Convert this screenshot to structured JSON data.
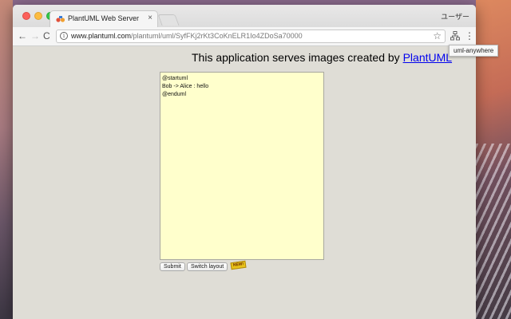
{
  "browser": {
    "tab_title": "PlantUML Web Server",
    "tab_close": "×",
    "profile_name": "ユーザー",
    "url_host": "www.plantuml.com",
    "url_path": "/plantuml/uml/SyfFKj2rKt3CoKnELR1Io4ZDoSa70000",
    "extension_tooltip": "uml-anywhere",
    "back": "←",
    "forward": "→",
    "reload": "C",
    "star": "☆",
    "menu": "⋮",
    "info": "i"
  },
  "page": {
    "heading_prefix": "This application serves images created by ",
    "heading_link": "PlantUML",
    "editor_text": "@startuml\nBob -> Alice : hello\n@enduml",
    "submit_label": "Submit",
    "switch_layout_label": "Switch layout",
    "new_badge": "NEW!"
  },
  "colors": {
    "editor_background": "#ffffcc",
    "page_background": "#dfddd6",
    "link": "#0000ee",
    "badge": "#e8c21a"
  },
  "icons": {
    "favicon": "plantuml-favicon",
    "info": "info-icon",
    "star": "star-icon",
    "extension": "uml-anywhere-extension-icon",
    "menu": "kebab-menu-icon"
  }
}
